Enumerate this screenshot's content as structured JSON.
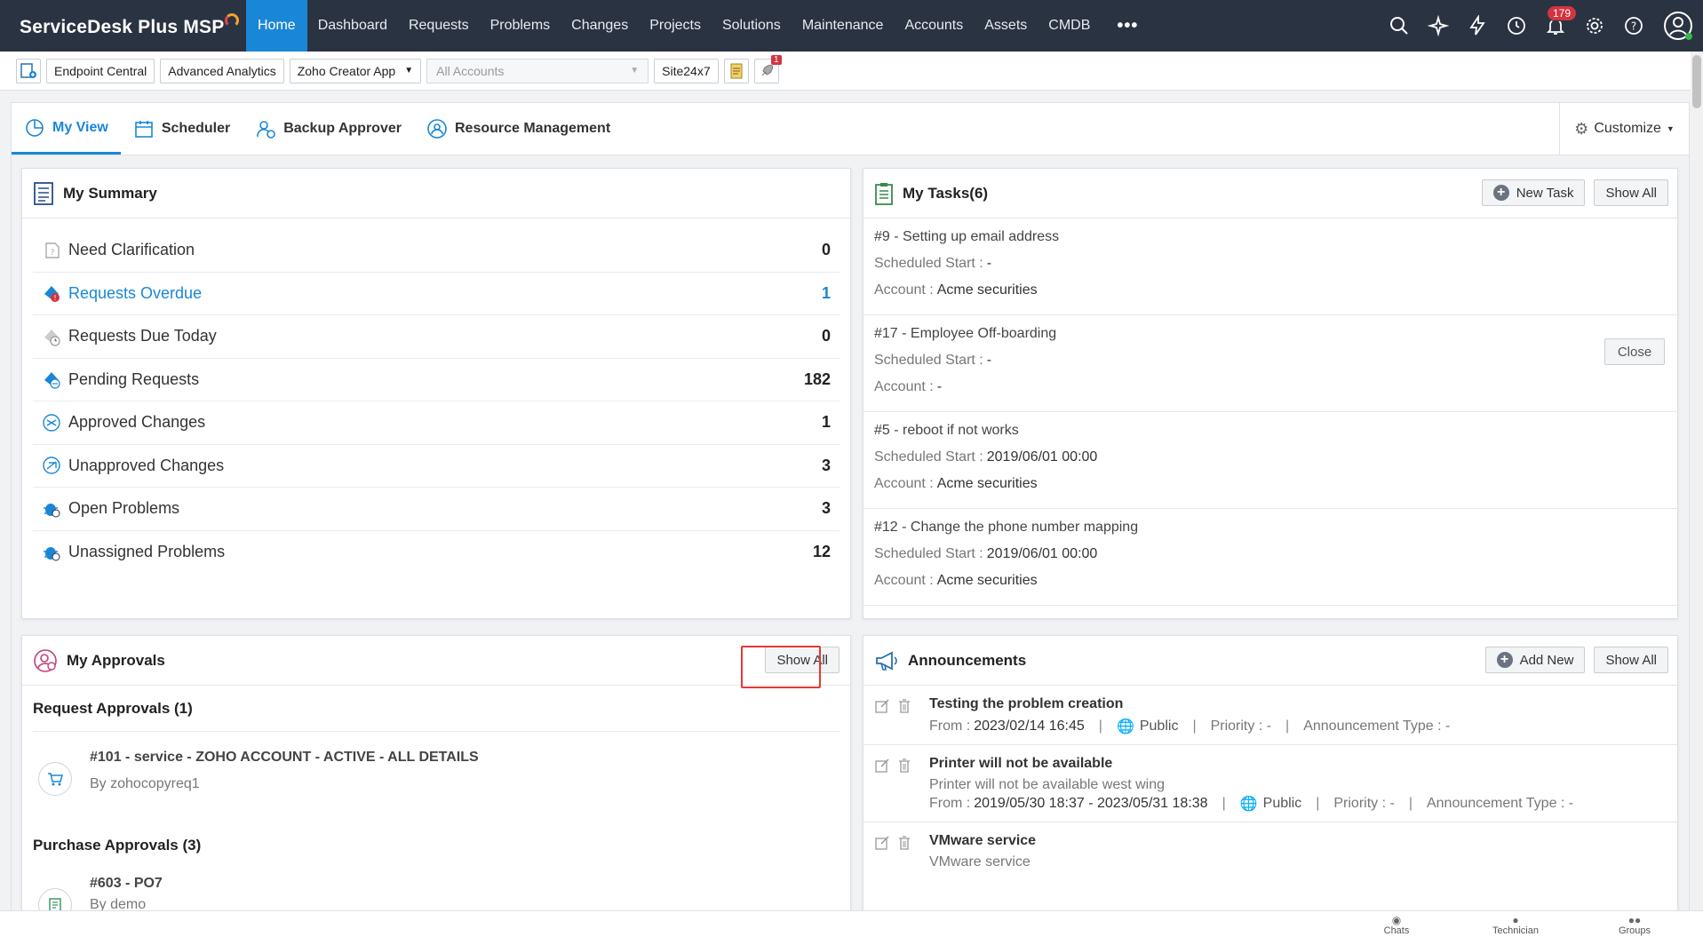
{
  "brand": {
    "name": "ServiceDesk Plus MSP"
  },
  "nav": {
    "items": [
      "Home",
      "Dashboard",
      "Requests",
      "Problems",
      "Changes",
      "Projects",
      "Solutions",
      "Maintenance",
      "Accounts",
      "Assets",
      "CMDB"
    ],
    "more": "•••",
    "notification_count": "179"
  },
  "quickbar": {
    "endpoint": "Endpoint Central",
    "analytics": "Advanced Analytics",
    "creator": "Zoho Creator App",
    "accounts_placeholder": "All Accounts",
    "site": "Site24x7",
    "rocket_badge": "1"
  },
  "tabs": {
    "items": [
      "My View",
      "Scheduler",
      "Backup Approver",
      "Resource Management"
    ],
    "customize": "Customize"
  },
  "summary": {
    "title": "My Summary",
    "rows": [
      {
        "label": "Need Clarification",
        "value": "0"
      },
      {
        "label": "Requests Overdue",
        "value": "1"
      },
      {
        "label": "Requests Due Today",
        "value": "0"
      },
      {
        "label": "Pending Requests",
        "value": "182"
      },
      {
        "label": "Approved Changes",
        "value": "1"
      },
      {
        "label": "Unapproved Changes",
        "value": "3"
      },
      {
        "label": "Open Problems",
        "value": "3"
      },
      {
        "label": "Unassigned Problems",
        "value": "12"
      }
    ]
  },
  "tasks": {
    "title": "My Tasks(6)",
    "new_task": "New Task",
    "show_all": "Show All",
    "scheduled_label": "Scheduled Start :",
    "account_label": "Account :",
    "close_label": "Close",
    "items": [
      {
        "title": "#9 - Setting up email address",
        "scheduled": "-",
        "account": "Acme securities"
      },
      {
        "title": "#17 - Employee Off-boarding",
        "scheduled": "-",
        "account": "-"
      },
      {
        "title": "#5 - reboot if not works",
        "scheduled": "2019/06/01 00:00",
        "account": "Acme securities"
      },
      {
        "title": "#12 - Change the phone number mapping",
        "scheduled": "2019/06/01 00:00",
        "account": "Acme securities"
      }
    ]
  },
  "approvals": {
    "title": "My Approvals",
    "show_all": "Show All",
    "request_head": "Request Approvals (1)",
    "request_item": {
      "title": "#101 - service - ZOHO ACCOUNT - ACTIVE - ALL DETAILS",
      "by": "By zohocopyreq1"
    },
    "purchase_head": "Purchase Approvals (3)",
    "purchase_item": {
      "title": "#603 - PO7",
      "by": "By demo"
    }
  },
  "announcements": {
    "title": "Announcements",
    "add_new": "Add New",
    "show_all": "Show All",
    "from_label": "From :",
    "public": "Public",
    "priority": "Priority : -",
    "type": "Announcement Type : -",
    "items": [
      {
        "title": "Testing the problem creation",
        "desc": "",
        "from": "2023/02/14 16:45"
      },
      {
        "title": "Printer will not be available",
        "desc": "Printer will not be available west wing",
        "from": "2019/05/30 18:37 -  2023/05/31 18:38"
      },
      {
        "title": "VMware service",
        "desc": "VMware service",
        "from": ""
      }
    ]
  },
  "bottombar": {
    "chats": "Chats",
    "technician": "Technician",
    "groups": "Groups"
  },
  "colors": {
    "nav_bg": "#2a3342",
    "accent": "#1a87d6",
    "badge": "#d3343f",
    "highlight": "#e53935"
  }
}
